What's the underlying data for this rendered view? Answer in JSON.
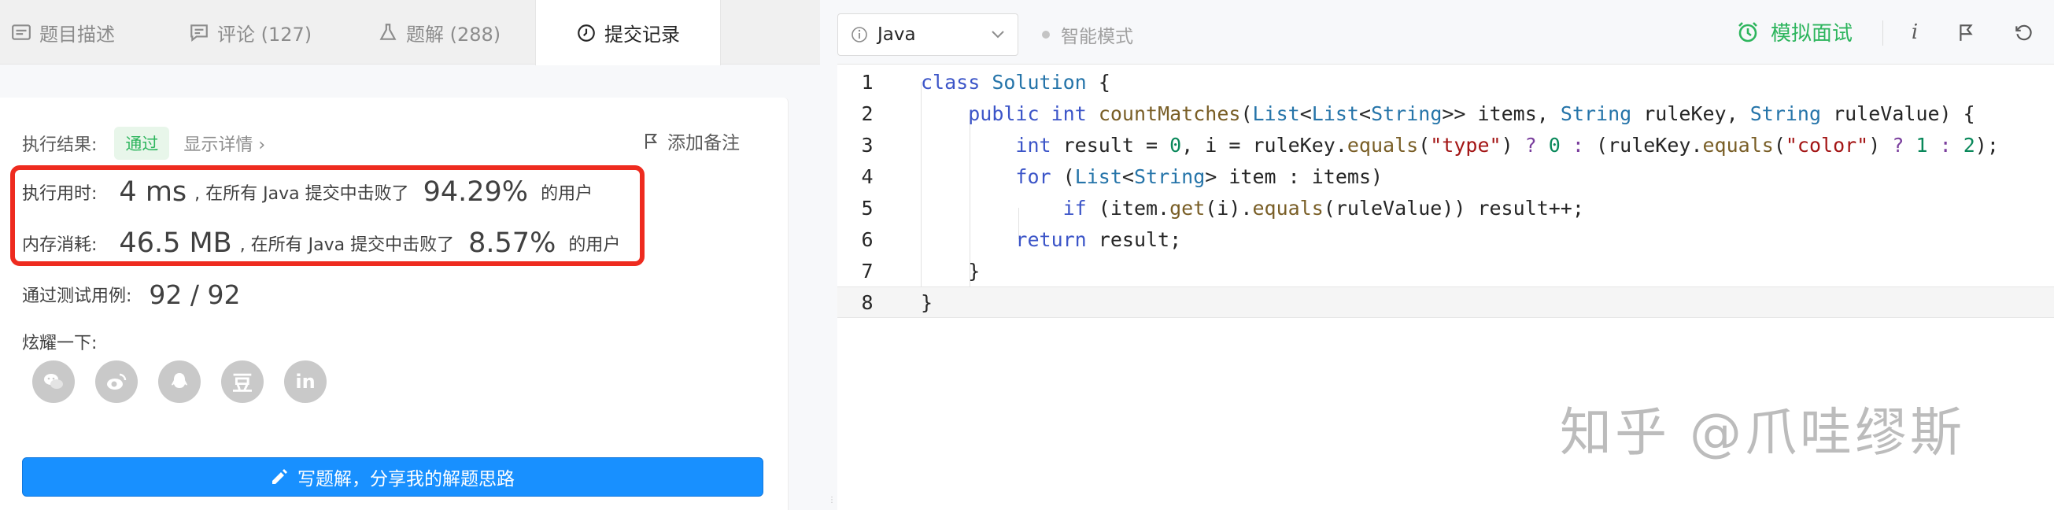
{
  "tabs": [
    {
      "label": "题目描述",
      "icon": "description-icon"
    },
    {
      "label": "评论 (127)",
      "icon": "comment-icon"
    },
    {
      "label": "题解 (288)",
      "icon": "flask-icon"
    },
    {
      "label": "提交记录",
      "icon": "clock-icon",
      "active": true
    }
  ],
  "result": {
    "label": "执行结果:",
    "status": "通过",
    "detail_link": "显示详情 ›",
    "add_note": "添加备注",
    "runtime_label": "执行用时:",
    "runtime_value": "4 ms",
    "runtime_mid": ", 在所有 Java 提交中击败了",
    "runtime_pct": "94.29%",
    "runtime_tail": "的用户",
    "memory_label": "内存消耗:",
    "memory_value": "46.5 MB",
    "memory_mid": ", 在所有 Java 提交中击败了",
    "memory_pct": "8.57%",
    "memory_tail": "的用户",
    "tests_label": "通过测试用例:",
    "tests_value": "92 / 92",
    "share_label": "炫耀一下:",
    "share_icons": [
      "wechat-icon",
      "weibo-icon",
      "qq-icon",
      "douban-icon",
      "linkedin-icon"
    ],
    "douban_glyph": "豆",
    "linkedin_glyph": "in",
    "write_button": "写题解，分享我的解题思路"
  },
  "toolbar": {
    "language": "Java",
    "smart_mode": "智能模式",
    "mock_interview": "模拟面试",
    "info_glyph": "i"
  },
  "code": {
    "line_numbers": [
      "1",
      "2",
      "3",
      "4",
      "5",
      "6",
      "7",
      "8"
    ],
    "lines": [
      "class Solution {",
      "    public int countMatches(List<List<String>> items, String ruleKey, String ruleValue) {",
      "        int result = 0, i = ruleKey.equals(\"type\") ? 0 : (ruleKey.equals(\"color\") ? 1 : 2);",
      "        for (List<String> item : items)",
      "            if (item.get(i).equals(ruleValue)) result++;",
      "        return result;",
      "    }",
      "}"
    ]
  },
  "watermark": "知乎 @爪哇缪斯",
  "colors": {
    "accent": "#1890ff",
    "success": "#2db55d",
    "highlight_box": "#ee2b1f"
  }
}
